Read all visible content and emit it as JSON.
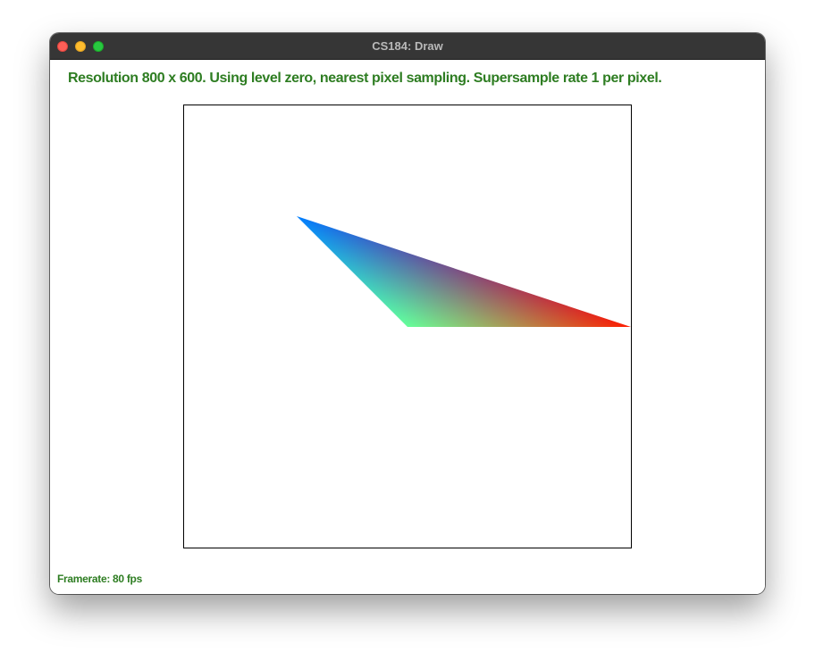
{
  "window": {
    "title": "CS184: Draw",
    "controls": {
      "close": "close-button",
      "minimize": "minimize-button",
      "zoom": "zoom-button"
    }
  },
  "status": {
    "text": "Resolution 800 x 600. Using level zero, nearest pixel sampling. Supersample rate 1 per pixel."
  },
  "canvas": {
    "triangle_colors": {
      "blue": "#0000ff",
      "green": "#00ff00",
      "red": "#ff0000"
    }
  },
  "footer": {
    "framerate": "Framerate: 80 fps"
  }
}
